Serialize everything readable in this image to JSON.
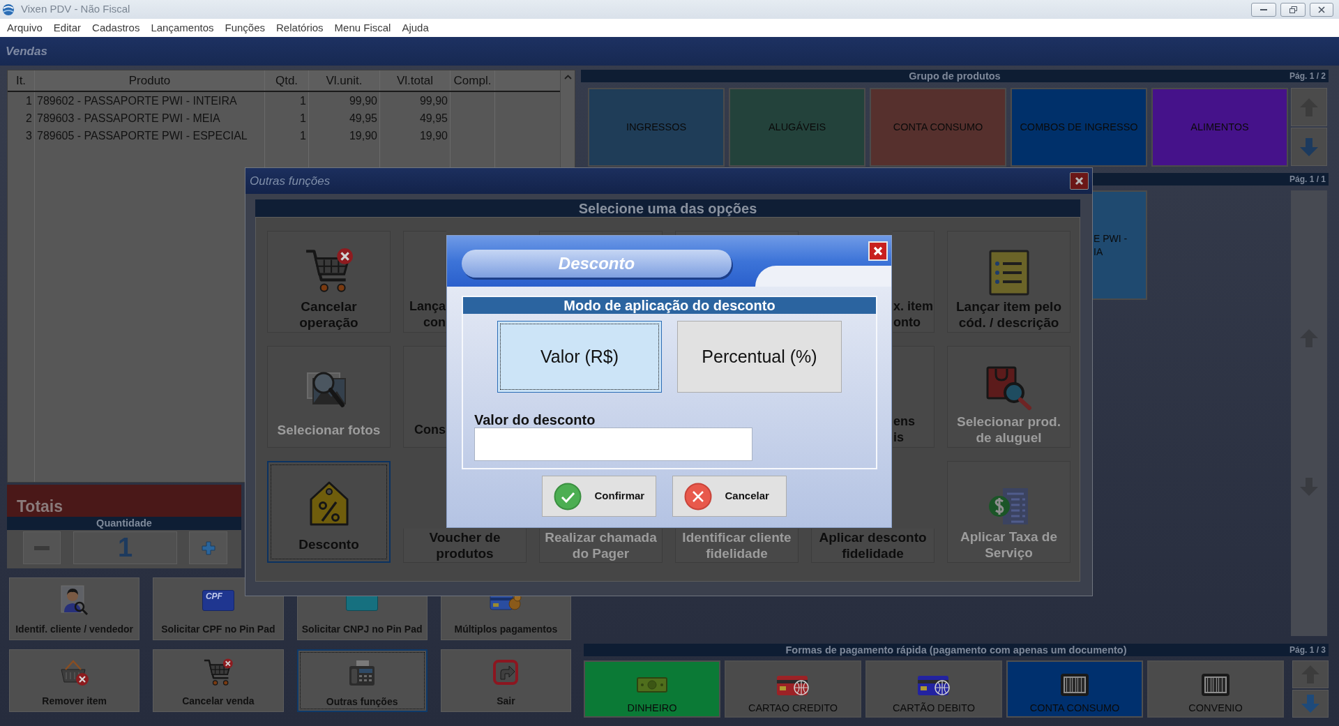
{
  "window": {
    "title": "Vixen PDV - Não Fiscal"
  },
  "menu": [
    "Arquivo",
    "Editar",
    "Cadastros",
    "Lançamentos",
    "Funções",
    "Relatórios",
    "Menu Fiscal",
    "Ajuda"
  ],
  "sales": {
    "title": "Vendas",
    "columns": [
      "It.",
      "Produto",
      "Qtd.",
      "Vl.unit.",
      "Vl.total",
      "Compl."
    ],
    "rows": [
      {
        "item": "1",
        "product": "789602 - PASSAPORTE PWI - INTEIRA",
        "qty": "1",
        "unit_price": "99,90",
        "total": "99,90"
      },
      {
        "item": "2",
        "product": "789603 - PASSAPORTE PWI - MEIA",
        "qty": "1",
        "unit_price": "49,95",
        "total": "49,95"
      },
      {
        "item": "3",
        "product": "789605 - PASSAPORTE PWI - ESPECIAL",
        "qty": "1",
        "unit_price": "19,90",
        "total": "19,90"
      }
    ]
  },
  "totals": {
    "title": "Totais",
    "quantity_label": "Quantidade",
    "quantity": "1"
  },
  "actions": [
    {
      "label": "Identif. cliente / vendedor",
      "focused": false
    },
    {
      "label": "Solicitar CPF no Pin Pad",
      "icon_text": "CPF",
      "focused": false
    },
    {
      "label": "Solicitar CNPJ no Pin Pad",
      "focused": false
    },
    {
      "label": "Múltiplos pagamentos",
      "focused": false
    },
    {
      "label": "Remover item",
      "focused": false
    },
    {
      "label": "Cancelar venda",
      "focused": false
    },
    {
      "label": "Outras funções",
      "focused": true
    },
    {
      "label": "Sair",
      "focused": false
    }
  ],
  "product_groups": {
    "title": "Grupo de produtos",
    "page": "Pág. 1 / 2",
    "items": [
      {
        "label": "INGRESSOS",
        "color": "#1f3d58"
      },
      {
        "label": "ALUGÁVEIS",
        "color": "#23423b"
      },
      {
        "label": "CONTA CONSUMO",
        "color": "#56302d"
      },
      {
        "label": "COMBOS DE INGRESSO",
        "color": "#00306a"
      },
      {
        "label": "ALIMENTOS",
        "color": "#45128a"
      }
    ]
  },
  "products": {
    "page": "Pág. 1 / 1",
    "items": [
      {
        "label": "E PWI -\nIA"
      }
    ]
  },
  "payments": {
    "title": "Formas de pagamento rápida (pagamento com apenas um documento)",
    "page": "Pág. 1 / 3",
    "items": [
      {
        "label": "DINHEIRO",
        "color": "#0b7a36"
      },
      {
        "label": "CARTAO CREDITO",
        "color": "#4b4b4b"
      },
      {
        "label": "CARTÃO DEBITO",
        "color": "#4b4b4b"
      },
      {
        "label": "CONTA CONSUMO",
        "color": "#00306e"
      },
      {
        "label": "CONVENIO",
        "color": "#4b4b4b"
      }
    ]
  },
  "other_functions": {
    "title": "Outras funções",
    "heading": "Selecione uma das opções",
    "tiles": [
      {
        "kind": "full",
        "label": "Cancelar\noperação",
        "disabled": false,
        "focused": false
      },
      {
        "kind": "cut_right",
        "label": "Lança\ncon",
        "disabled": false
      },
      {
        "kind": "edge"
      },
      {
        "kind": "edge"
      },
      {
        "kind": "cut_left",
        "label": "x. item\nonto",
        "disabled": false
      },
      {
        "kind": "full",
        "label": "Lançar item pelo\ncód. / descrição",
        "disabled": false,
        "focused": false
      },
      {
        "kind": "full",
        "label": "Selecionar fotos",
        "disabled": true,
        "focused": false
      },
      {
        "kind": "cut_right",
        "label": "Cons",
        "disabled": false
      },
      {
        "kind": "hidden"
      },
      {
        "kind": "hidden"
      },
      {
        "kind": "cut_left",
        "label": "ens\nis",
        "disabled": false
      },
      {
        "kind": "full",
        "label": "Selecionar prod.\nde aluguel",
        "disabled": true,
        "focused": false
      },
      {
        "kind": "full",
        "label": "Desconto",
        "disabled": false,
        "focused": true
      },
      {
        "kind": "cut_top",
        "label": "Voucher de\nprodutos",
        "disabled": false,
        "focused": false
      },
      {
        "kind": "cut_top",
        "label": "Realizar chamada\ndo Pager",
        "disabled": true,
        "focused": false
      },
      {
        "kind": "cut_top",
        "label": "Identificar cliente\nfidelidade",
        "disabled": true,
        "focused": false
      },
      {
        "kind": "cut_top",
        "label": "Aplicar desconto\nfidelidade",
        "disabled": false,
        "focused": false
      },
      {
        "kind": "full",
        "label": "Aplicar Taxa de\nServiço",
        "disabled": true,
        "focused": false
      }
    ]
  },
  "discount_dialog": {
    "title": "Desconto",
    "section_title": "Modo de aplicação do desconto",
    "modes": [
      {
        "label": "Valor (R$)",
        "selected": true
      },
      {
        "label": "Percentual (%)",
        "selected": false
      }
    ],
    "amount_label": "Valor do desconto",
    "buttons": [
      {
        "kind": "confirm",
        "label": "Confirmar"
      },
      {
        "kind": "cancel",
        "label": "Cancelar"
      }
    ]
  }
}
